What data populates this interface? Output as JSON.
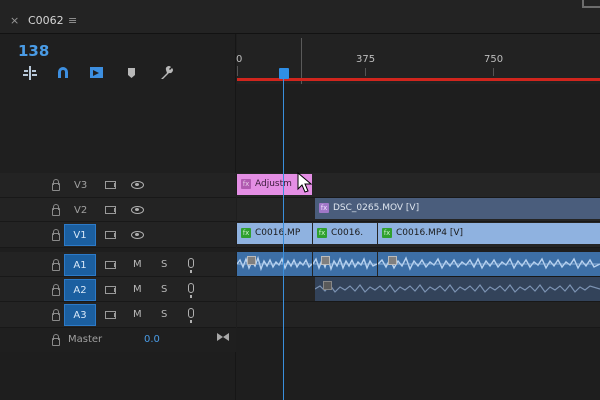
{
  "sequence": {
    "close": "×",
    "name": "C0062",
    "menu": "≡"
  },
  "timecode": "138",
  "tools": [
    "snap-ripple-icon",
    "magnet-icon",
    "linked-selection-icon",
    "marker-icon",
    "wrench-icon"
  ],
  "ruler": {
    "labels": [
      "0",
      "375",
      "750"
    ]
  },
  "tracks": {
    "video": [
      {
        "name": "V3",
        "targeted": false
      },
      {
        "name": "V2",
        "targeted": false
      },
      {
        "name": "V1",
        "targeted": true
      }
    ],
    "audio": [
      {
        "name": "A1",
        "m": "M",
        "s": "S"
      },
      {
        "name": "A2",
        "m": "M",
        "s": "S"
      },
      {
        "name": "A3",
        "m": "M",
        "s": "S"
      }
    ],
    "master": {
      "label": "Master",
      "value": "0.0"
    }
  },
  "clips": {
    "v3": {
      "label": "Adjustm",
      "color": "#e48ee4"
    },
    "v2": {
      "label": "DSC_0265.MOV [V]",
      "color": "#4a5d7c"
    },
    "v1": [
      {
        "label": "C0016.MP"
      },
      {
        "label": "C0016."
      },
      {
        "label": "C0016.MP4 [V]"
      }
    ]
  },
  "colors": {
    "accent": "#2f8fe6",
    "render_bar": "#d0251d",
    "video_clip": "#8fb2e0",
    "audio_clip": "#3d6fa6",
    "adjustment_clip": "#e48ee4"
  }
}
